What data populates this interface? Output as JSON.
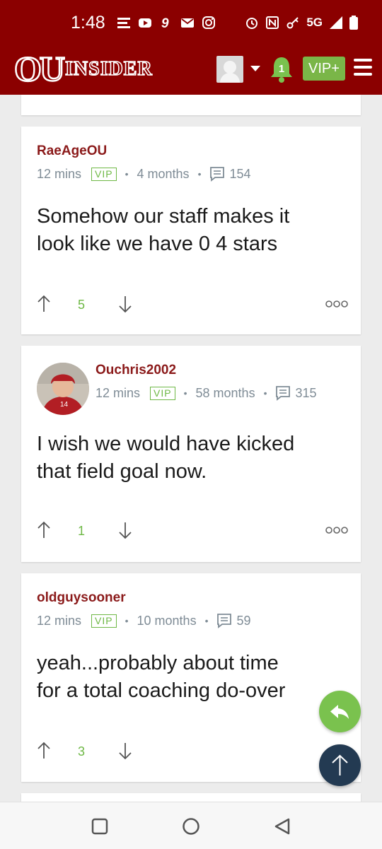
{
  "status": {
    "time": "1:48",
    "network": "5G"
  },
  "app": {
    "logo_text": "OUINSIDER",
    "notifications": "1",
    "vip_button": "VIP+"
  },
  "posts": [
    {
      "username": "RaeAgeOU",
      "posted": "12 mins",
      "badge": "VIP",
      "member_for": "4 months",
      "comments": "154",
      "body_lines": [
        "Somehow our staff makes it",
        "look like we have 0 4 stars"
      ],
      "votes": "5"
    },
    {
      "username": "Ouchris2002",
      "posted": "12 mins",
      "badge": "VIP",
      "member_for": "58 months",
      "comments": "315",
      "body_lines": [
        "I wish we would have kicked",
        "that field goal now."
      ],
      "votes": "1"
    },
    {
      "username": "oldguysooner",
      "posted": "12 mins",
      "badge": "VIP",
      "member_for": "10 months",
      "comments": "59",
      "body_lines": [
        "yeah...probably about time",
        "for a total coaching do-over"
      ],
      "votes": "3"
    }
  ],
  "icons": {
    "upvote": "arrow-up-icon",
    "downvote": "arrow-down-icon",
    "more": "more-options-icon",
    "reply": "reply-icon",
    "scroll_top": "scroll-to-top-icon"
  },
  "colors": {
    "brand": "#8b0000",
    "accent_green": "#7ab648",
    "username": "#8b1a1a",
    "fab_dark": "#233a52"
  }
}
